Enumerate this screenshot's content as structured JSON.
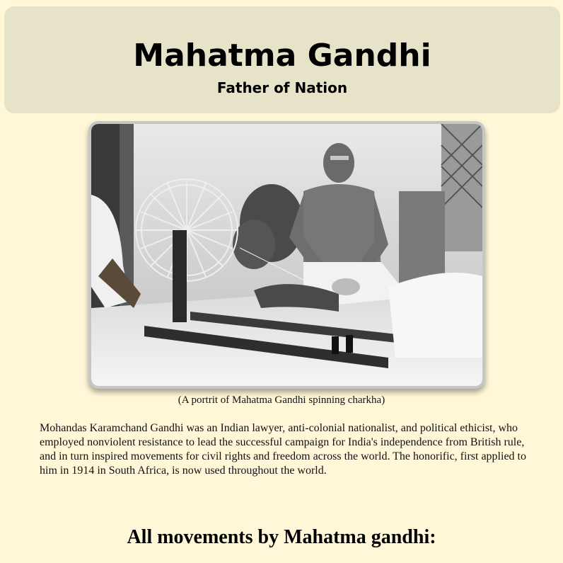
{
  "header": {
    "title": "Mahatma Gandhi",
    "subtitle": "Father of Nation",
    "background_color": "#e6e3c9"
  },
  "photo": {
    "caption": "(A portrit of Mahatma Gandhi spinning charkha)",
    "style": "black-and-white photograph"
  },
  "bio": {
    "text": "Mohandas Karamchand Gandhi was an Indian lawyer, anti-colonial nationalist, and political ethicist, who employed nonviolent resistance to lead the successful campaign for India's independence from British rule, and in turn inspired movements for civil rights and freedom across the world. The honorific, first applied to him in 1914 in South Africa, is now used throughout the world."
  },
  "section": {
    "title": "All movements by Mahatma gandhi:"
  },
  "page": {
    "background_color": "#fff7d8"
  }
}
